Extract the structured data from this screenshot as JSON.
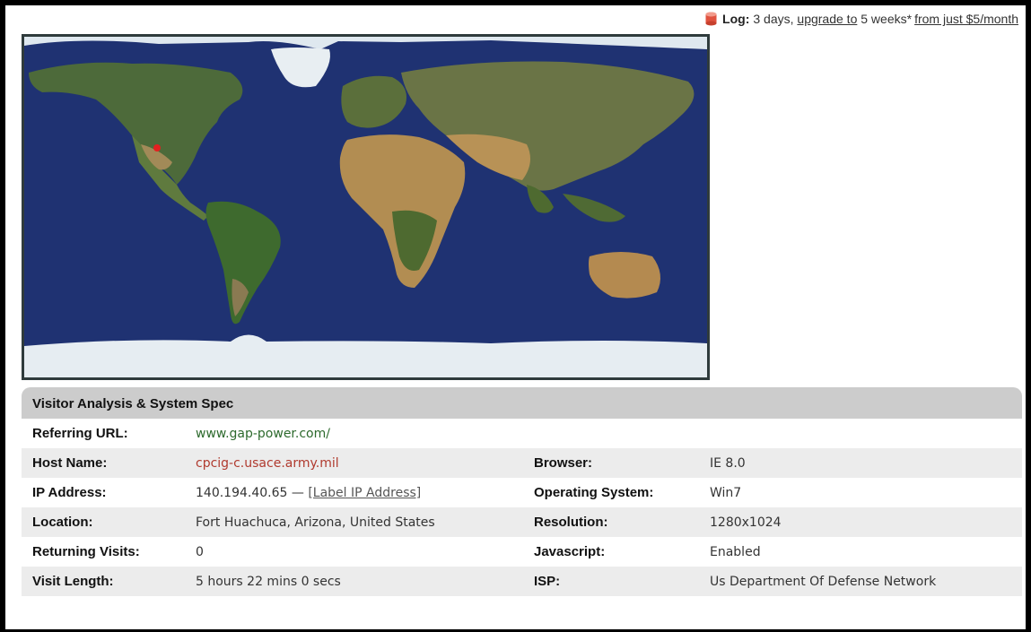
{
  "log_bar": {
    "label": "Log:",
    "retention": "3 days,",
    "upgrade_link": "upgrade to",
    "upgrade_target": "5 weeks*",
    "price_link": "from just $5/month"
  },
  "map": {
    "ocean_color": "#1f3272",
    "marker_color": "#e32020",
    "marker_label": "visitor-location"
  },
  "analysis": {
    "title": "Visitor Analysis & System Spec",
    "rows": [
      {
        "label": "Referring URL:",
        "value": "www.gap-power.com/",
        "label2": "",
        "value2": ""
      },
      {
        "label": "Host Name:",
        "value": "cpcig-c.usace.army.mil",
        "label2": "Browser:",
        "value2": "IE 8.0"
      },
      {
        "label": "IP Address:",
        "value": "140.194.40.65 —",
        "value_link": "[Label IP Address]",
        "label2": "Operating System:",
        "value2": "Win7"
      },
      {
        "label": "Location:",
        "value": "Fort Huachuca, Arizona, United States",
        "label2": "Resolution:",
        "value2": "1280x1024"
      },
      {
        "label": "Returning Visits:",
        "value": "0",
        "label2": "Javascript:",
        "value2": "Enabled"
      },
      {
        "label": "Visit Length:",
        "value": "5 hours 22 mins 0 secs",
        "label2": "ISP:",
        "value2": "Us Department Of Defense Network"
      }
    ]
  },
  "colors": {
    "header_bg": "#cccccc",
    "row_alt": "#ececec",
    "referrer_green": "#2d6a2d",
    "host_red": "#b03a2e"
  }
}
